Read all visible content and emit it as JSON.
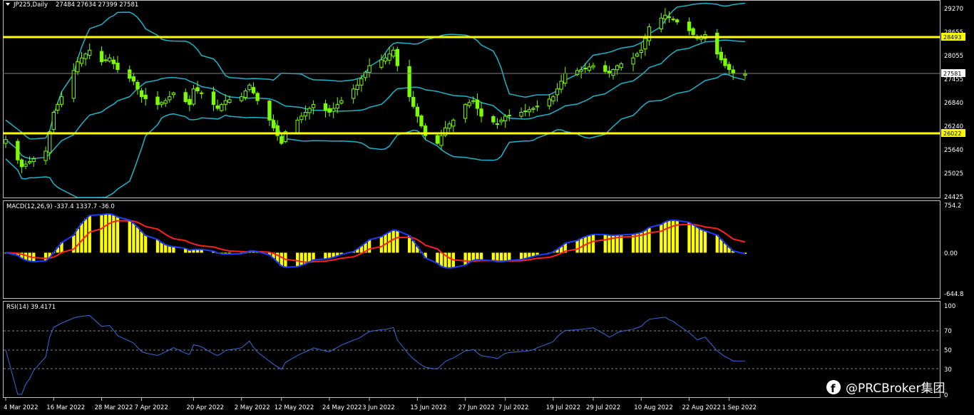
{
  "colors": {
    "background": "#000000",
    "frame": "#c0c0c0",
    "candle": "#7cfc00",
    "bollinger": "#20b2c8",
    "level": "#ffff00",
    "macd_hist": "#ffff00",
    "macd_line": "#1e3cff",
    "signal_line": "#ff2020",
    "rsi_line": "#3b6ad8"
  },
  "header": {
    "symbol_label": "JP225,Daily",
    "ohlc": "27484 27634 27399 27581",
    "menu_icon": "triangle-down-icon"
  },
  "price_axis": {
    "ticks": [
      "29270",
      "28655",
      "28055",
      "27455",
      "26840",
      "26240",
      "25640",
      "25025",
      "24425"
    ],
    "current_price": "27581",
    "resistance": "28493",
    "support": "26022"
  },
  "macd": {
    "title": "MACD(12,26,9) -337.4 1337.7 -36.0",
    "ticks": [
      "754.2",
      "0.00",
      "-644.8"
    ]
  },
  "rsi": {
    "title": "RSI(14) 39.4171",
    "ticks": [
      "100",
      "70",
      "50",
      "30",
      "0"
    ]
  },
  "dates": [
    "4 Mar 2022",
    "16 Mar 2022",
    "28 Mar 2022",
    "7 Apr 2022",
    "20 Apr 2022",
    "2 May 2022",
    "12 May 2022",
    "24 May 2022",
    "3 Jun 2022",
    "15 Jun 2022",
    "27 Jun 2022",
    "7 Jul 2022",
    "19 Jul 2022",
    "29 Jul 2022",
    "10 Aug 2022",
    "22 Aug 2022",
    "1 Sep 2022"
  ],
  "watermark": {
    "text": "@PRCBroker集团",
    "icon": "facebook-icon"
  },
  "chart_data": {
    "type": "candlestick",
    "symbol": "JP225",
    "timeframe": "Daily",
    "last_ohlc": {
      "open": 27484,
      "high": 27634,
      "low": 27399,
      "close": 27581
    },
    "horizontal_levels": [
      28493,
      26022
    ],
    "close_anchors": [
      [
        "2022-03-04",
        25900
      ],
      [
        "2022-03-08",
        25200
      ],
      [
        "2022-03-11",
        25400
      ],
      [
        "2022-03-14",
        25600
      ],
      [
        "2022-03-16",
        26600
      ],
      [
        "2022-03-18",
        27000
      ],
      [
        "2022-03-22",
        27900
      ],
      [
        "2022-03-25",
        28200
      ],
      [
        "2022-03-28",
        27900
      ],
      [
        "2022-03-30",
        28000
      ],
      [
        "2022-04-01",
        27700
      ],
      [
        "2022-04-05",
        27400
      ],
      [
        "2022-04-07",
        27000
      ],
      [
        "2022-04-11",
        26800
      ],
      [
        "2022-04-13",
        26900
      ],
      [
        "2022-04-15",
        27100
      ],
      [
        "2022-04-19",
        26800
      ],
      [
        "2022-04-20",
        27200
      ],
      [
        "2022-04-22",
        27100
      ],
      [
        "2022-04-26",
        26700
      ],
      [
        "2022-04-28",
        26900
      ],
      [
        "2022-05-02",
        27000
      ],
      [
        "2022-05-04",
        27300
      ],
      [
        "2022-05-06",
        26900
      ],
      [
        "2022-05-09",
        26400
      ],
      [
        "2022-05-12",
        25800
      ],
      [
        "2022-05-13",
        26100
      ],
      [
        "2022-05-17",
        26500
      ],
      [
        "2022-05-20",
        26800
      ],
      [
        "2022-05-24",
        26600
      ],
      [
        "2022-05-27",
        26900
      ],
      [
        "2022-05-31",
        27300
      ],
      [
        "2022-06-03",
        27800
      ],
      [
        "2022-06-07",
        28000
      ],
      [
        "2022-06-09",
        28200
      ],
      [
        "2022-06-10",
        27800
      ],
      [
        "2022-06-13",
        27000
      ],
      [
        "2022-06-15",
        26500
      ],
      [
        "2022-06-17",
        26000
      ],
      [
        "2022-06-20",
        25800
      ],
      [
        "2022-06-22",
        26200
      ],
      [
        "2022-06-24",
        26400
      ],
      [
        "2022-06-27",
        26800
      ],
      [
        "2022-06-29",
        26900
      ],
      [
        "2022-07-01",
        26500
      ],
      [
        "2022-07-05",
        26300
      ],
      [
        "2022-07-07",
        26500
      ],
      [
        "2022-07-11",
        26600
      ],
      [
        "2022-07-14",
        26700
      ],
      [
        "2022-07-19",
        27000
      ],
      [
        "2022-07-22",
        27600
      ],
      [
        "2022-07-26",
        27700
      ],
      [
        "2022-07-29",
        27800
      ],
      [
        "2022-08-02",
        27600
      ],
      [
        "2022-08-04",
        27800
      ],
      [
        "2022-08-08",
        28000
      ],
      [
        "2022-08-10",
        28200
      ],
      [
        "2022-08-12",
        28800
      ],
      [
        "2022-08-16",
        29100
      ],
      [
        "2022-08-18",
        29000
      ],
      [
        "2022-08-22",
        28700
      ],
      [
        "2022-08-24",
        28500
      ],
      [
        "2022-08-26",
        28600
      ],
      [
        "2022-08-29",
        28100
      ],
      [
        "2022-08-31",
        27800
      ],
      [
        "2022-09-02",
        27600
      ],
      [
        "2022-09-05",
        27581
      ]
    ],
    "indicators": [
      {
        "name": "Bollinger Bands"
      },
      {
        "name": "MACD(12,26,9)",
        "values": {
          "main": -337.4,
          "signal": 1337.7,
          "third": -36.0
        },
        "ylim": [
          -644.8,
          754.2
        ]
      },
      {
        "name": "RSI(14)",
        "value": 39.4171,
        "levels": [
          70,
          50,
          30
        ],
        "ylim": [
          0,
          100
        ]
      }
    ]
  }
}
